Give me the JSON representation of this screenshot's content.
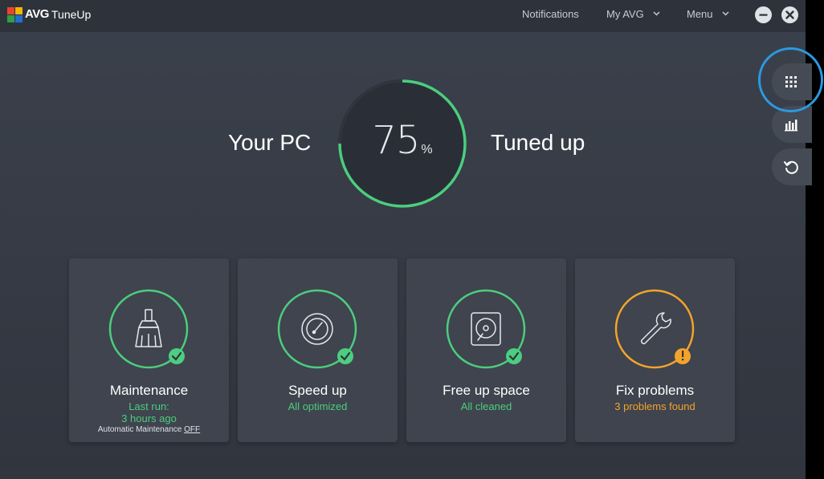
{
  "header": {
    "brand": "AVG",
    "product": "TuneUp",
    "nav": {
      "notifications": "Notifications",
      "my_avg": "My AVG",
      "menu": "Menu"
    },
    "icons": {
      "minimize": "minimize-icon",
      "close": "close-icon",
      "chevron": "chevron-down-icon"
    }
  },
  "hero": {
    "left_text": "Your PC",
    "right_text": "Tuned up",
    "score": "75",
    "unit": "%",
    "progress": 0.75
  },
  "side_rail": {
    "items": [
      "grid-icon",
      "bar-chart-icon",
      "undo-icon"
    ]
  },
  "cards": [
    {
      "title": "Maintenance",
      "status_line1": "Last run:",
      "status_line2": "3 hours ago",
      "footer_prefix": "Automatic Maintenance ",
      "footer_link": "OFF",
      "icon": "broom-icon",
      "badge": "check-icon"
    },
    {
      "title": "Speed up",
      "status": "All optimized",
      "icon": "speedometer-icon",
      "badge": "check-icon"
    },
    {
      "title": "Free up space",
      "status": "All cleaned",
      "icon": "hard-drive-icon",
      "badge": "check-icon"
    },
    {
      "title": "Fix problems",
      "status": "3 problems found",
      "icon": "wrench-icon",
      "badge": "warning-icon"
    }
  ],
  "colors": {
    "accent_green": "#4ccd7f",
    "warning_orange": "#f3a32b",
    "highlight_blue": "#2b9ae2",
    "card_bg": "#3f444e"
  }
}
